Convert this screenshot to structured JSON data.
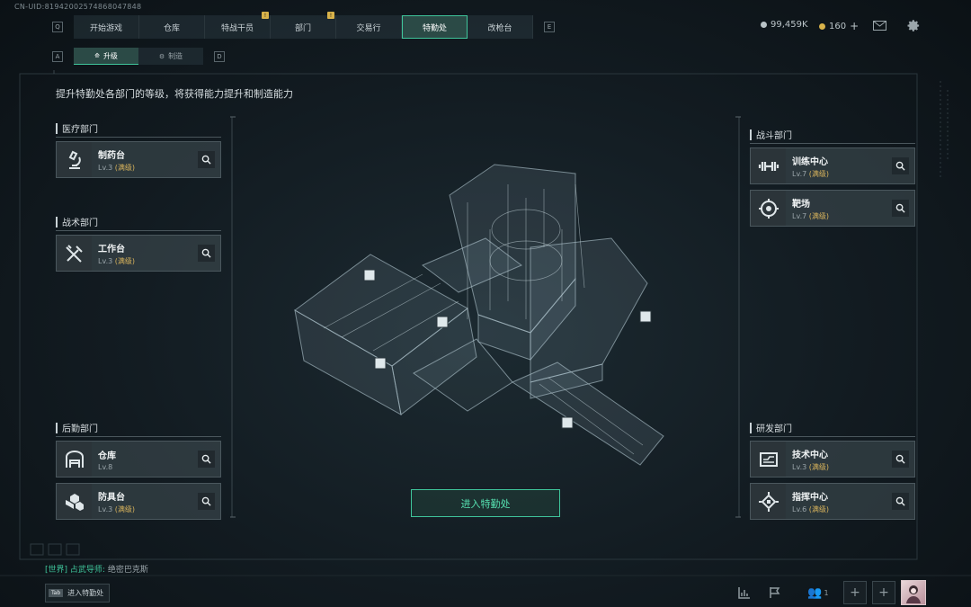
{
  "user_id": "CN-UID:81942002574868047848",
  "nav": {
    "key_left": "Q",
    "key_right": "E",
    "tabs": [
      {
        "label": "开始游戏",
        "notif": false,
        "active": false
      },
      {
        "label": "仓库",
        "notif": false,
        "active": false
      },
      {
        "label": "特战干员",
        "notif": true,
        "active": false
      },
      {
        "label": "部门",
        "notif": true,
        "active": false
      },
      {
        "label": "交易行",
        "notif": false,
        "active": false
      },
      {
        "label": "特勤处",
        "notif": false,
        "active": true
      },
      {
        "label": "改枪台",
        "notif": false,
        "active": false
      }
    ],
    "notif_mark": "!"
  },
  "resources": {
    "currency": "99,459K",
    "premium": "160",
    "premium_add": "+"
  },
  "subnav": {
    "key_left": "A",
    "key_right": "D",
    "tabs": [
      {
        "label": "升级",
        "active": true
      },
      {
        "label": "制造",
        "active": false
      }
    ]
  },
  "description": "提升特勤处各部门的等级，将获得能力提升和制造能力",
  "left_depts": [
    {
      "name": "医疗部门",
      "items": [
        {
          "name": "制药台",
          "level": "Lv.3",
          "max": "(满级)",
          "icon": "microscope-icon"
        }
      ]
    },
    {
      "name": "战术部门",
      "items": [
        {
          "name": "工作台",
          "level": "Lv.3",
          "max": "(满级)",
          "icon": "wrench-hammer-icon"
        }
      ]
    },
    {
      "name": "后勤部门",
      "items": [
        {
          "name": "仓库",
          "level": "Lv.8",
          "max": "",
          "icon": "warehouse-icon"
        },
        {
          "name": "防具台",
          "level": "Lv.3",
          "max": "(满级)",
          "icon": "cubes-icon"
        }
      ]
    }
  ],
  "right_depts": [
    {
      "name": "战斗部门",
      "items": [
        {
          "name": "训练中心",
          "level": "Lv.7",
          "max": "(满级)",
          "icon": "dumbbell-icon"
        },
        {
          "name": "靶场",
          "level": "Lv.7",
          "max": "(满级)",
          "icon": "target-icon"
        }
      ]
    },
    {
      "name": "研发部门",
      "items": [
        {
          "name": "技术中心",
          "level": "Lv.3",
          "max": "(满级)",
          "icon": "circuit-board-icon"
        },
        {
          "name": "指挥中心",
          "level": "Lv.6",
          "max": "(满级)",
          "icon": "chip-icon"
        }
      ]
    }
  ],
  "enter_button": "进入特勤处",
  "chat": {
    "channel": "[世界]",
    "speaker": "占武导师:",
    "message": "绝密巴克斯"
  },
  "tab_hint": {
    "key": "Tab",
    "label": "进入特勤处"
  },
  "bottom": {
    "friends_count": "1",
    "add": "+"
  },
  "colors": {
    "accent": "#3fc59b",
    "max_level": "#d9b45c",
    "notif": "#d8b24a"
  }
}
